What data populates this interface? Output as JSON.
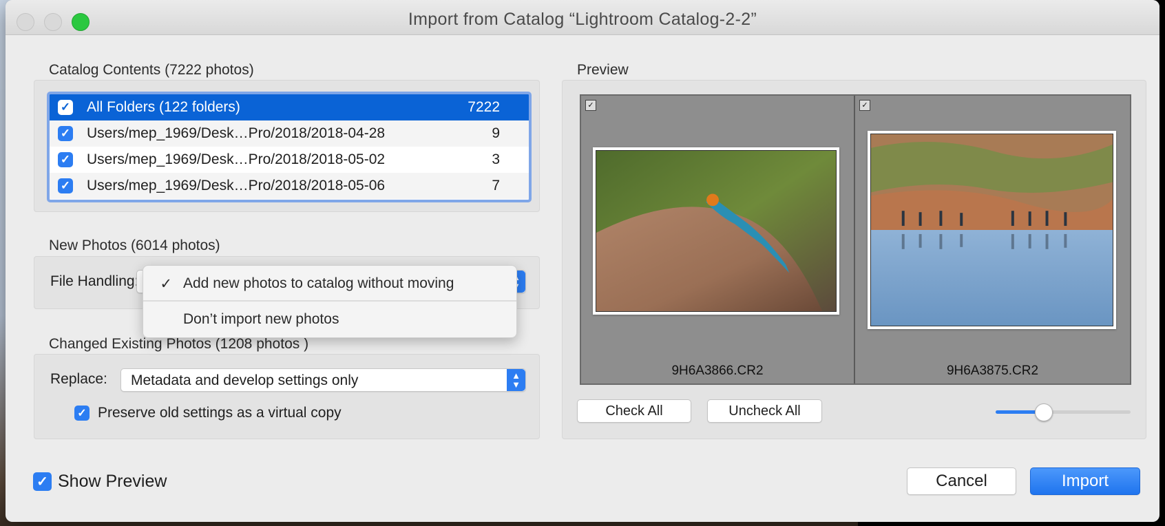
{
  "window": {
    "title": "Import from Catalog “Lightroom Catalog-2-2”"
  },
  "catalog_contents": {
    "label": "Catalog Contents (7222 photos)",
    "folders": [
      {
        "name": "All Folders (122 folders)",
        "count": "7222",
        "checked": true,
        "selected": true
      },
      {
        "name": "Users/mep_1969/Desk…Pro/2018/2018-04-28",
        "count": "9",
        "checked": true,
        "selected": false
      },
      {
        "name": "Users/mep_1969/Desk…Pro/2018/2018-05-02",
        "count": "3",
        "checked": true,
        "selected": false
      },
      {
        "name": "Users/mep_1969/Desk…Pro/2018/2018-05-06",
        "count": "7",
        "checked": true,
        "selected": false
      }
    ]
  },
  "new_photos": {
    "label": "New Photos (6014 photos)",
    "file_handling_label": "File Handling:",
    "dropdown_options": [
      {
        "label": "Add new photos to catalog without moving",
        "checked": true
      },
      {
        "label": "Don’t import new photos",
        "checked": false
      }
    ]
  },
  "changed_photos": {
    "label": "Changed Existing Photos (1208 photos )",
    "replace_label": "Replace:",
    "replace_value": "Metadata and develop settings only",
    "preserve_label": "Preserve old settings as a virtual copy",
    "preserve_checked": true
  },
  "preview": {
    "label": "Preview",
    "items": [
      {
        "filename": "9H6A3866.CR2",
        "checked": true,
        "image": "lizard-on-rock"
      },
      {
        "filename": "9H6A3875.CR2",
        "checked": true,
        "image": "hikers-reflection-lake"
      }
    ],
    "check_all_label": "Check All",
    "uncheck_all_label": "Uncheck All",
    "thumbnail_size_fraction": 0.35
  },
  "footer": {
    "show_preview_label": "Show Preview",
    "show_preview_checked": true,
    "cancel_label": "Cancel",
    "import_label": "Import"
  },
  "colors": {
    "accent": "#2c7df2",
    "selection": "#0a63d6",
    "close_button": "#d9d9d9",
    "zoom_button": "#2bc840"
  }
}
